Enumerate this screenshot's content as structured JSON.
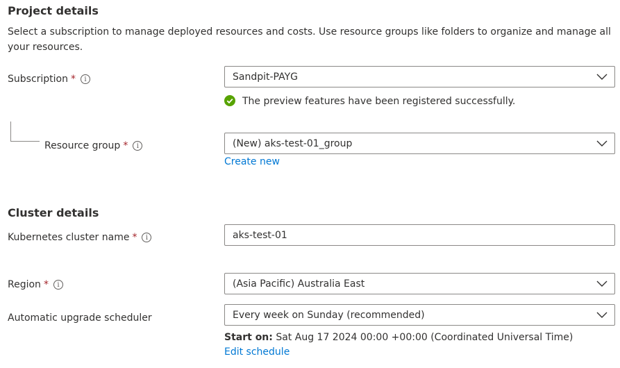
{
  "project": {
    "title": "Project details",
    "description": "Select a subscription to manage deployed resources and costs. Use resource groups like folders to organize and manage all your resources.",
    "subscription": {
      "label": "Subscription",
      "required": "*",
      "value": "Sandpit-PAYG",
      "success_message": "The preview features have been registered successfully."
    },
    "resource_group": {
      "label": "Resource group",
      "required": "*",
      "value": "(New) aks-test-01_group",
      "create_new": "Create new"
    }
  },
  "cluster": {
    "title": "Cluster details",
    "name": {
      "label": "Kubernetes cluster name",
      "required": "*",
      "value": "aks-test-01"
    },
    "region": {
      "label": "Region",
      "required": "*",
      "value": "(Asia Pacific) Australia East"
    },
    "upgrade": {
      "label": "Automatic upgrade scheduler",
      "value": "Every week on Sunday (recommended)",
      "start_label": "Start on:",
      "start_value": "Sat Aug 17 2024 00:00 +00:00 (Coordinated Universal Time)",
      "edit_link": "Edit schedule"
    }
  },
  "icons": {
    "info": "info-icon",
    "success": "check-circle-icon",
    "chevron": "chevron-down-icon"
  },
  "colors": {
    "link": "#0078d4",
    "success": "#57a300",
    "required": "#a4262c",
    "border": "#8a8886"
  }
}
